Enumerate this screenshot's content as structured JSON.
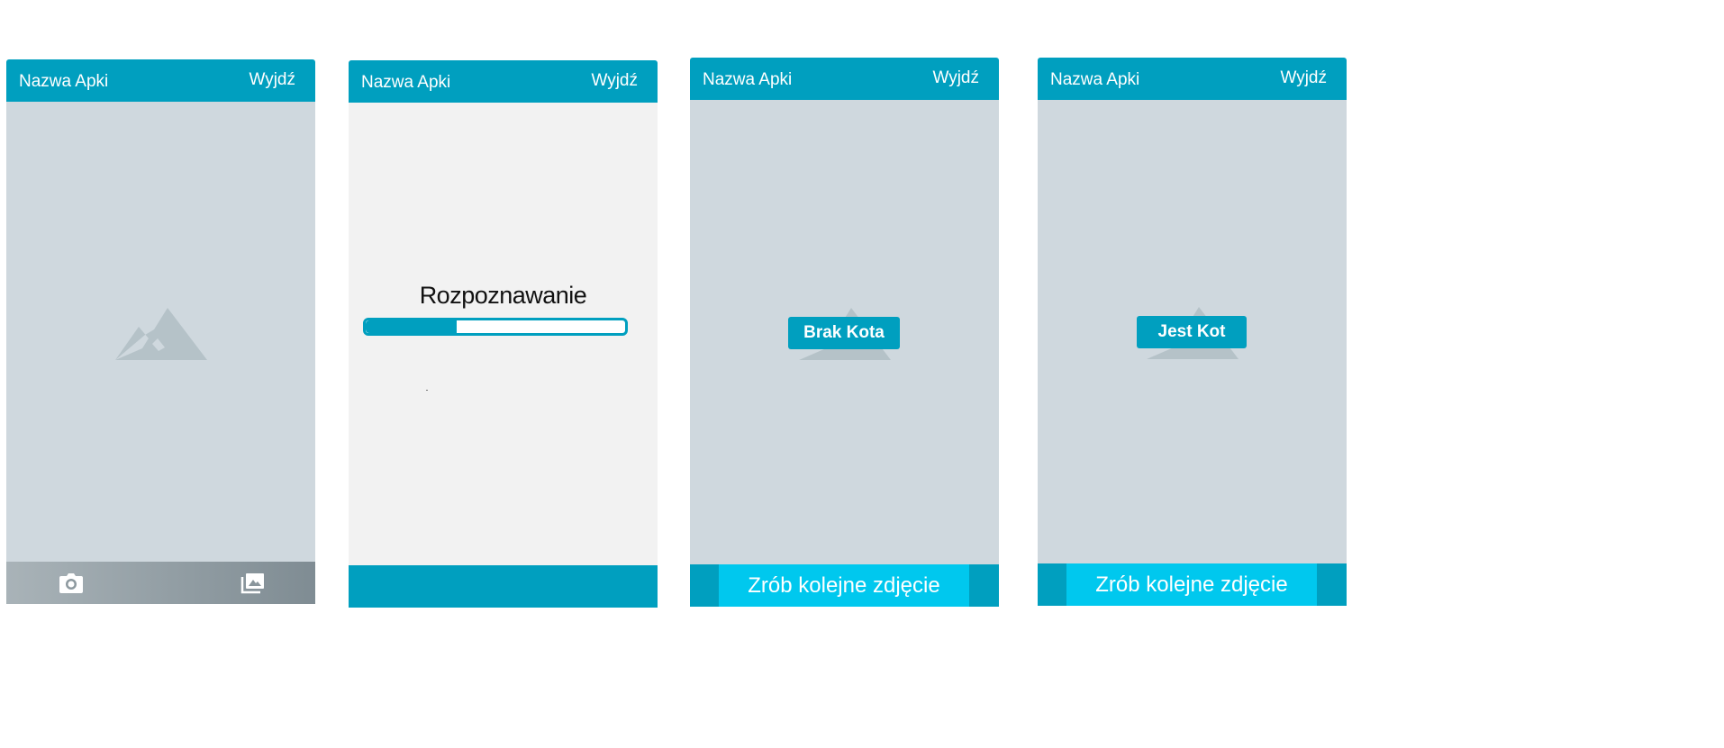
{
  "screens": [
    {
      "header": {
        "app_name": "Nazwa Apki",
        "exit_label": "Wyjdź"
      },
      "placeholder_icon": "mountain-image-icon",
      "bottom_bar": {
        "camera_icon": "camera-icon",
        "gallery_icon": "gallery-icon"
      }
    },
    {
      "header": {
        "app_name": "Nazwa Apki",
        "exit_label": "Wyjdź"
      },
      "progress": {
        "label": "Rozpoznawanie",
        "value": 0.35
      }
    },
    {
      "header": {
        "app_name": "Nazwa Apki",
        "exit_label": "Wyjdź"
      },
      "result_label": "Brak Kota",
      "retake_label": "Zrób kolejne zdjęcie"
    },
    {
      "header": {
        "app_name": "Nazwa Apki",
        "exit_label": "Wyjdź"
      },
      "result_label": "Jest Kot",
      "retake_label": "Zrób kolejne zdjęcie"
    }
  ],
  "colors": {
    "accent": "#009fbf",
    "button_light": "#00c8ee",
    "placeholder_bg": "#cfd8de",
    "loading_bg": "#f2f2f2"
  }
}
